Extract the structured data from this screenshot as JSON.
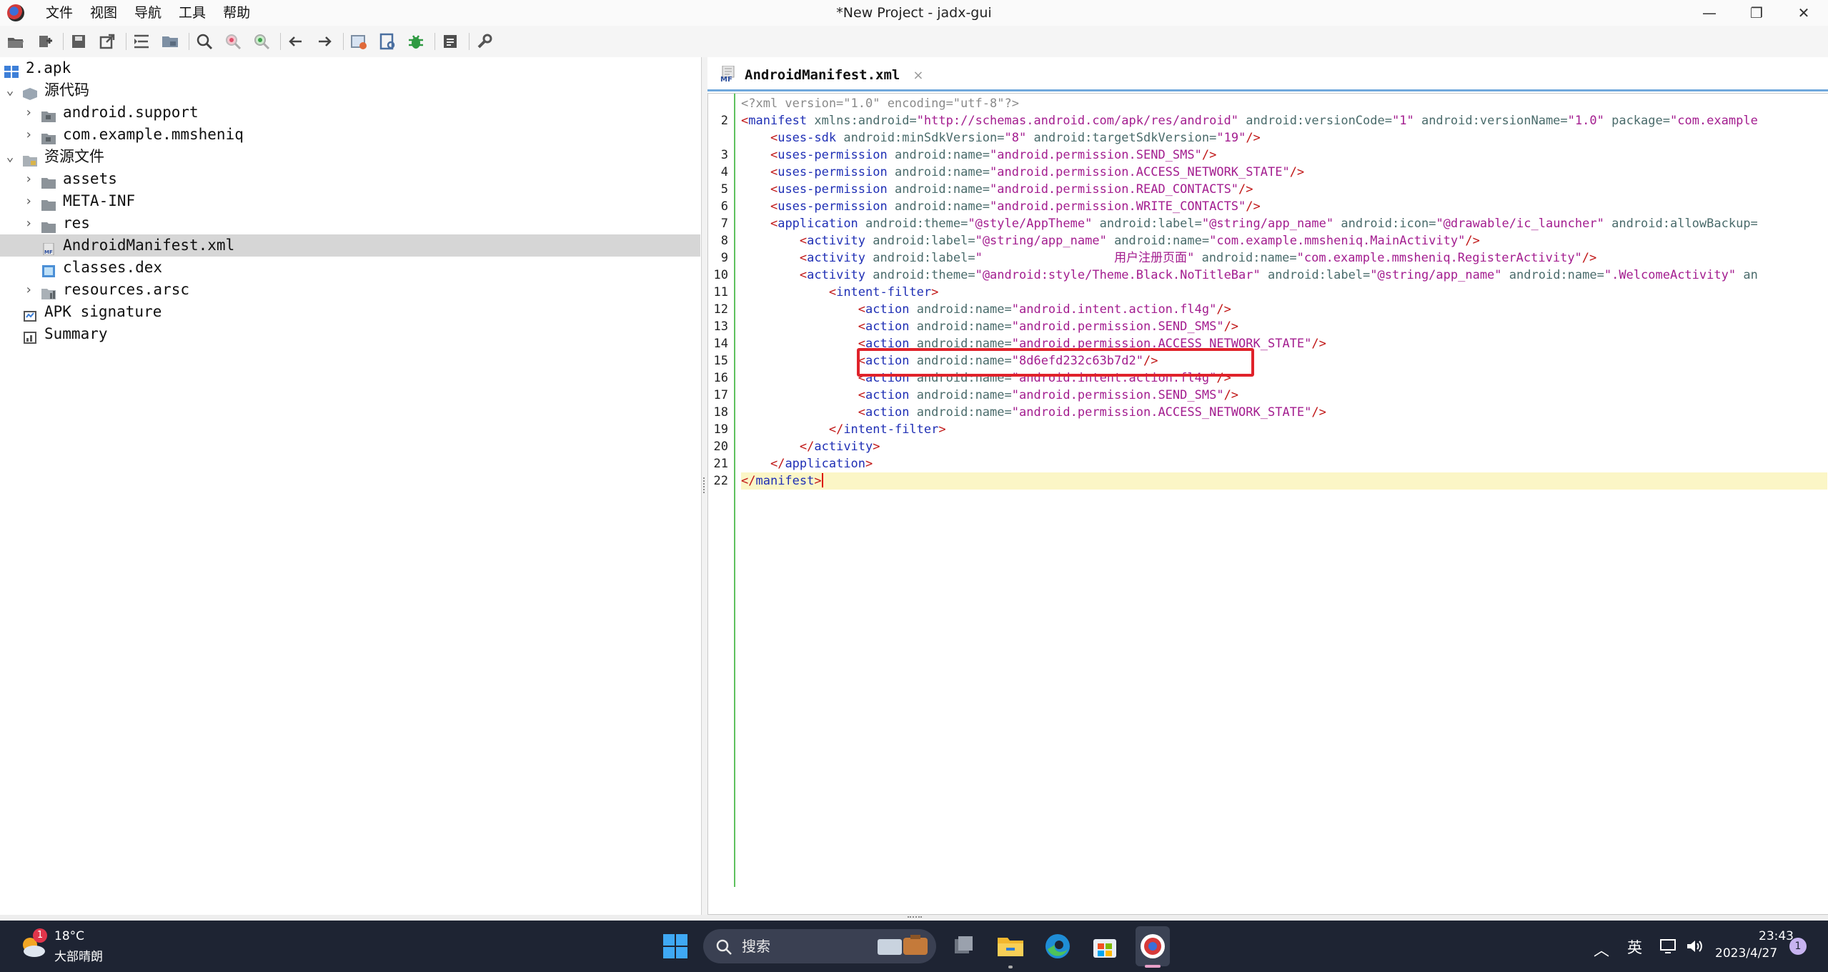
{
  "window": {
    "title": "*New Project - jadx-gui",
    "controls": {
      "minimize": "—",
      "restore": "❐",
      "close": "✕"
    }
  },
  "menu": [
    "文件",
    "视图",
    "导航",
    "工具",
    "帮助"
  ],
  "toolbar": {
    "icons": [
      "open-file-icon",
      "add-files-icon",
      "save-icon",
      "export-icon",
      "sync-tree-icon",
      "flatten-packages-icon",
      "search-icon",
      "search-class-icon",
      "search-usage-icon",
      "back-icon",
      "forward-icon",
      "decompile-all-icon",
      "deobfuscation-icon",
      "debugger-icon",
      "log-viewer-icon",
      "preferences-icon"
    ]
  },
  "tree": {
    "root": "2.apk",
    "source_node": "源代码",
    "packages": [
      "android.support",
      "com.example.mmsheniq"
    ],
    "resources_node": "资源文件",
    "resource_folders": [
      "assets",
      "META-INF",
      "res"
    ],
    "selected_file": "AndroidManifest.xml",
    "files": [
      "classes.dex",
      "resources.arsc"
    ],
    "apk_signature": "APK signature",
    "summary": "Summary"
  },
  "editor": {
    "tab_label": "AndroidManifest.xml",
    "tab_icon_text": "MF",
    "tab_close": "×",
    "line_numbers": [
      "",
      "2",
      "",
      "3",
      "4",
      "5",
      "6",
      "7",
      "8",
      "9",
      "10",
      "11",
      "12",
      "13",
      "14",
      "15",
      "16",
      "17",
      "18",
      "19",
      "20",
      "21",
      "22"
    ],
    "code": {
      "l0_pi": "<?xml version=\"1.0\" encoding=\"utf-8\"?>",
      "l1_tag": "manifest",
      "l1_attr1": "xmlns:android=",
      "l1_val1": "\"http://schemas.android.com/apk/res/android\"",
      "l1_attr2": "android:versionCode=",
      "l1_val2": "\"1\"",
      "l1_attr3": "android:versionName=",
      "l1_val3": "\"1.0\"",
      "l1_attr4": "package=",
      "l1_val4": "\"com.example",
      "l2_tag": "uses-sdk",
      "l2_attr1": "android:minSdkVersion=",
      "l2_val1": "\"8\"",
      "l2_attr2": "android:targetSdkVersion=",
      "l2_val2": "\"19\"",
      "perm_tag": "uses-permission",
      "name_attr": "android:name=",
      "l3_val": "\"android.permission.SEND_SMS\"",
      "l4_val": "\"android.permission.ACCESS_NETWORK_STATE\"",
      "l5_val": "\"android.permission.READ_CONTACTS\"",
      "l6_val": "\"android.permission.WRITE_CONTACTS\"",
      "app_tag": "application",
      "l7_attr1": "android:theme=",
      "l7_val1": "\"@style/AppTheme\"",
      "l7_attr2": "android:label=",
      "l7_val2": "\"@string/app_name\"",
      "l7_attr3": "android:icon=",
      "l7_val3": "\"@drawable/ic_launcher\"",
      "l7_attr4": "android:allowBackup=",
      "activity_tag": "activity",
      "label_attr": "android:label=",
      "l8_val1": "\"@string/app_name\"",
      "l8_val2": "\"com.example.mmsheniq.MainActivity\"",
      "l9_val1_pre": "\"",
      "l9_val1_cn": "用户注册页面",
      "l9_val1_post": "\"",
      "l9_val2": "\"com.example.mmsheniq.RegisterActivity\"",
      "theme_attr": "android:theme=",
      "l10_val1": "\"@android:style/Theme.Black.NoTitleBar\"",
      "l10_val2": "\"@string/app_name\"",
      "l10_val3": "\".WelcomeActivity\"",
      "l10_tail": "an",
      "intent_tag": "intent-filter",
      "action_tag": "action",
      "l12_val": "\"android.intent.action.fl4g\"",
      "l13_val": "\"android.permission.SEND_SMS\"",
      "l14_val": "\"android.permission.ACCESS_NETWORK_STATE\"",
      "l15_val": "\"8d6efd232c63b7d2\"",
      "l16_val": "\"android.intent.action.fl4g\"",
      "l17_val": "\"android.permission.SEND_SMS\"",
      "l18_val": "\"android.permission.ACCESS_NETWORK_STATE\"",
      "l19_tag": "intent-filter",
      "l20_tag": "activity",
      "l21_tag": "application",
      "l22_tag": "manifest"
    }
  },
  "taskbar": {
    "weather_badge": "1",
    "weather_temp": "18°C",
    "weather_desc": "大部晴朗",
    "search_label": "搜索",
    "ime": "英",
    "clock_time": "23:43",
    "clock_date": "2023/4/27",
    "notification_count": "1",
    "tray_chevron": "︿"
  },
  "colors": {
    "xml_tag": "#1f2fb5",
    "xml_attr": "#4a6b6b",
    "xml_value": "#a31d8f",
    "xml_punct": "#c01515",
    "highlight_box": "#e0222a",
    "current_line": "#fbf6c6",
    "gutter_border": "#5fc15f",
    "taskbar": "#1e2433"
  }
}
